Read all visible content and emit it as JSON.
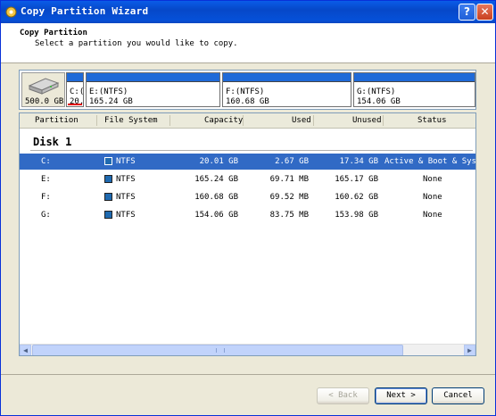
{
  "window": {
    "title": "Copy Partition Wizard",
    "icon": "wizard-app-icon",
    "help_label": "?",
    "close_label": "✕"
  },
  "header": {
    "title": "Copy Partition",
    "subtitle": "Select a partition you would like to copy."
  },
  "disk_map": {
    "disk": {
      "icon": "hard-disk-icon",
      "size": "500.0 GB"
    },
    "partitions": [
      {
        "line1": "C:(",
        "line2": "20."
      },
      {
        "line1": "E:(NTFS)",
        "line2": "165.24 GB"
      },
      {
        "line1": "F:(NTFS)",
        "line2": "160.68 GB"
      },
      {
        "line1": "G:(NTFS)",
        "line2": "154.06 GB"
      }
    ]
  },
  "table": {
    "columns": [
      "Partition",
      "File System",
      "Capacity",
      "Used",
      "Unused",
      "Status"
    ],
    "disk_label": "Disk 1",
    "rows": [
      {
        "partition": "C:",
        "fs": "NTFS",
        "capacity": "20.01 GB",
        "used": "2.67 GB",
        "unused": "17.34 GB",
        "status": "Active & Boot & System",
        "selected": true
      },
      {
        "partition": "E:",
        "fs": "NTFS",
        "capacity": "165.24 GB",
        "used": "69.71 MB",
        "unused": "165.17 GB",
        "status": "None",
        "selected": false
      },
      {
        "partition": "F:",
        "fs": "NTFS",
        "capacity": "160.68 GB",
        "used": "69.52 MB",
        "unused": "160.62 GB",
        "status": "None",
        "selected": false
      },
      {
        "partition": "G:",
        "fs": "NTFS",
        "capacity": "154.06 GB",
        "used": "83.75 MB",
        "unused": "153.98 GB",
        "status": "None",
        "selected": false
      }
    ]
  },
  "buttons": {
    "back": "< Back",
    "next": "Next >",
    "cancel": "Cancel"
  },
  "colors": {
    "title_bar": "#0a5ce8",
    "partition_bar": "#1f6ad8",
    "selection": "#316ac5",
    "used_marker": "#e01010"
  }
}
